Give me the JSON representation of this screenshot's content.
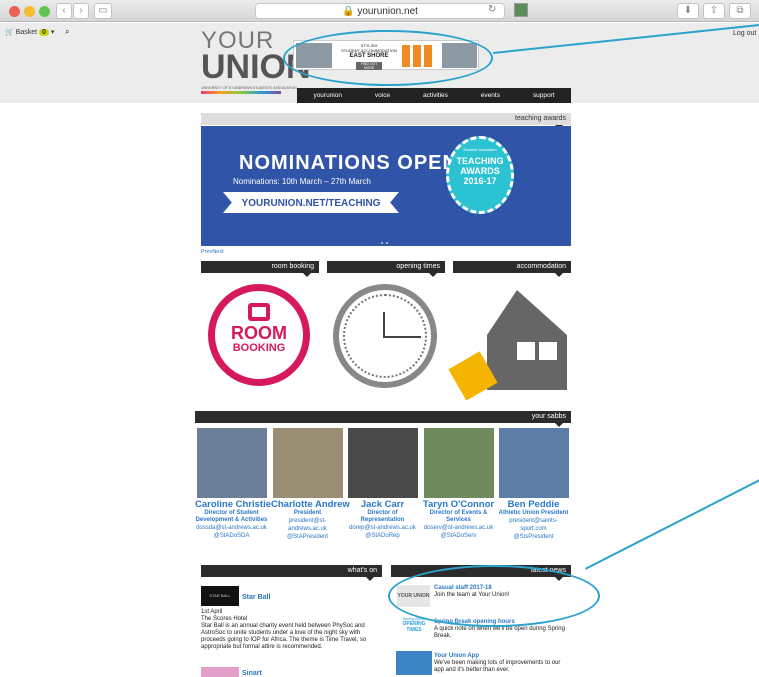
{
  "browser": {
    "url": "yourunion.net"
  },
  "topbar": {
    "basket_label": "Basket",
    "basket_count": "0",
    "logout_label": "Log out"
  },
  "logo": {
    "your": "YOUR",
    "union": "UNION",
    "tagline": "UNIVERSITY OF ST ANDREWS STUDENTS' ASSOCIATION"
  },
  "ad": {
    "line1": "STYLISH",
    "line2": "STUDENT ACCOMMODATION",
    "line3": "EAST SHORE",
    "cta": "FIND OUT MORE"
  },
  "nav": {
    "items": [
      "yourunion",
      "voice",
      "activities",
      "events",
      "support"
    ]
  },
  "hero": {
    "section": "teaching awards",
    "title": "NOMINATIONS OPEN",
    "dates": "Nominations: 10th March – 27th March",
    "url": "YOURUNION.NET/TEACHING",
    "badge_top": "TEACHING",
    "badge_mid": "AWARDS",
    "badge_year": "2016-17",
    "badge_small": "Students' Association"
  },
  "slider": {
    "prev": "Prev",
    "next": "Next"
  },
  "tiles": [
    {
      "label": "room booking"
    },
    {
      "label": "opening times"
    },
    {
      "label": "accommodation"
    }
  ],
  "room": {
    "line1": "ROOM",
    "line2": "BOOKING"
  },
  "sabbs_title": "your sabbs",
  "sabbs": [
    {
      "name": "Caroline Christie",
      "role": "Director of Student Development & Activities",
      "email": "dossda@st-andrews.ac.uk",
      "twitter": "@StADoSDA"
    },
    {
      "name": "Charlotte Andrew",
      "role": "President",
      "email": "president@st-andrews.ac.uk",
      "twitter": "@StAPresident"
    },
    {
      "name": "Jack Carr",
      "role": "Director of Representation",
      "email": "dorep@st-andrews.ac.uk",
      "twitter": "@StADoRep"
    },
    {
      "name": "Taryn O'Connor",
      "role": "Director of Events & Services",
      "email": "doserv@st-andrews.ac.uk",
      "twitter": "@StADoServ"
    },
    {
      "name": "Ben Peddie",
      "role": "Athletic Union President",
      "email": "president@saints-sport.com",
      "twitter": "@StsPresident"
    }
  ],
  "whatson": {
    "title": "what's on",
    "event1": {
      "name": "Star Ball",
      "thumb": "STAR BALL",
      "date": "1st April",
      "venue": "The Scores Hotel",
      "desc": "Star Ball is an annual charity event held between PhySoc and AstroSoc to unite students under a love of the night sky with proceeds going to IOP for Africa. The theme is Time Travel, so appropriate but formal attire is recommended."
    },
    "event2": {
      "name": "Sinart"
    }
  },
  "news": {
    "title": "latest news",
    "items": [
      {
        "title": "Casual staff 2017-18",
        "text": "Join the team at Your Union!",
        "thumb": "YOUR UNION"
      },
      {
        "title": "Spring Break opening hours",
        "text": "A quick note on when we'll be open during Spring Break.",
        "thumb": "OPENING TIMES",
        "thumb_top": "Spring Break"
      },
      {
        "title": "Your Union App",
        "text": "We've been making lots of improvements to our app and it's better than ever."
      }
    ]
  }
}
